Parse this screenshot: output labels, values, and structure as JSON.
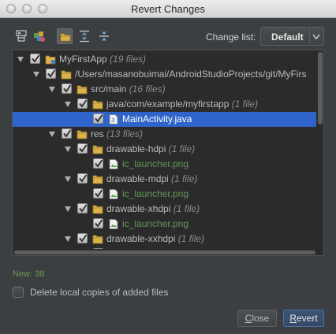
{
  "window": {
    "title": "Revert Changes"
  },
  "toolbar": {
    "buttons": [
      {
        "icon": "group-by-structure-icon"
      },
      {
        "icon": "group-by-module-icon"
      },
      {
        "icon": "show-flat-folders-icon",
        "selected": true
      },
      {
        "icon": "expand-all-icon"
      },
      {
        "icon": "collapse-all-icon"
      }
    ],
    "change_list_label": "Change list:",
    "change_list_value": "Default"
  },
  "tree": {
    "rows": [
      {
        "name": "MyFirstApp",
        "count": "(19 files)",
        "type": "module",
        "expanded": true,
        "checked": true
      },
      {
        "name": "/Users/masanobuimai/AndroidStudioProjects/git/MyFirs",
        "count": "",
        "type": "folder",
        "expanded": true,
        "checked": true
      },
      {
        "name": "src/main",
        "count": "(16 files)",
        "type": "folder",
        "expanded": true,
        "checked": true
      },
      {
        "name": "java/com/example/myfirstapp",
        "count": "(1 file)",
        "type": "folder",
        "expanded": true,
        "checked": true
      },
      {
        "name": "MainActivity.java",
        "count": "",
        "type": "java-file",
        "selected": true,
        "checked": true
      },
      {
        "name": "res",
        "count": "(13 files)",
        "type": "folder",
        "expanded": true,
        "checked": true
      },
      {
        "name": "drawable-hdpi",
        "count": "(1 file)",
        "type": "folder",
        "expanded": true,
        "checked": true
      },
      {
        "name": "ic_launcher.png",
        "count": "",
        "type": "image-file",
        "added": true,
        "checked": true
      },
      {
        "name": "drawable-mdpi",
        "count": "(1 file)",
        "type": "folder",
        "expanded": true,
        "checked": true
      },
      {
        "name": "ic_launcher.png",
        "count": "",
        "type": "image-file",
        "added": true,
        "checked": true
      },
      {
        "name": "drawable-xhdpi",
        "count": "(1 file)",
        "type": "folder",
        "expanded": true,
        "checked": true
      },
      {
        "name": "ic_launcher.png",
        "count": "",
        "type": "image-file",
        "added": true,
        "checked": true
      },
      {
        "name": "drawable-xxhdpi",
        "count": "(1 file)",
        "type": "folder",
        "expanded": true,
        "checked": true
      },
      {
        "name": "ic_launcher.png",
        "count": "",
        "type": "image-file",
        "added": true,
        "checked": true
      }
    ]
  },
  "status": {
    "new_count": "New: 38"
  },
  "options": {
    "delete_local_label": "Delete local copies of added files",
    "delete_local_checked": false
  },
  "buttons": {
    "close": {
      "mnemonic": "C",
      "rest": "lose"
    },
    "revert": {
      "mnemonic": "R",
      "rest": "evert"
    }
  },
  "colors": {
    "background": "#3c3f41",
    "tree_background": "#2b2b2b",
    "selection": "#2f65ca",
    "added_file": "#629755",
    "new_count": "#6a9955"
  }
}
